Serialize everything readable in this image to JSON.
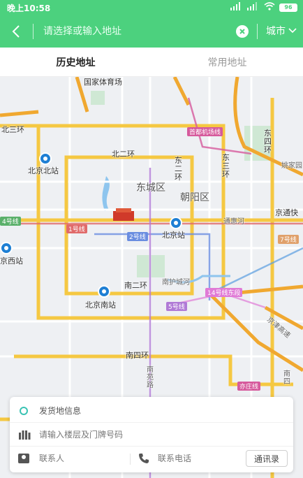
{
  "status_bar": {
    "time": "晚上10:58",
    "battery": "96"
  },
  "search": {
    "placeholder": "请选择或输入地址",
    "city_label": "城市"
  },
  "tabs": [
    {
      "label": "历史地址",
      "active": true
    },
    {
      "label": "常用地址",
      "active": false
    }
  ],
  "map": {
    "labels": {
      "stadium": "国家体育场",
      "north_3rd_ring": "北三环",
      "north_2nd_ring": "北二环",
      "east_2nd_ring": "东二环",
      "east_3rd_ring": "东三环",
      "east_4th_ring": "东四环",
      "dongcheng": "东城区",
      "chaoyang": "朝阳区",
      "beijing_north_station": "北京北站",
      "beijing_station": "北京站",
      "beijing_west_station": "京西站",
      "beijing_south_station": "北京南站",
      "south_2nd_ring": "南二环",
      "south_4th_ring": "南四环",
      "nanhucheng_river": "南护城河",
      "tonghui_river": "通惠河",
      "yaojia_road": "姚家园",
      "jingtong_express": "京通快",
      "south_central_road": "南苑路",
      "airport_line": "首都机场线",
      "line_1": "1号线",
      "line_2": "2号线",
      "line_4": "4号线",
      "line_5": "5号线",
      "line_7": "7号线",
      "line_14": "14号线东段",
      "yizhuang_line": "亦庄线",
      "jingjin_expressway": "京津高速",
      "south_4th_road": "南四"
    }
  },
  "card": {
    "origin_label": "发货地信息",
    "floor_placeholder": "请输入楼层及门牌号码",
    "contact_placeholder": "联系人",
    "phone_placeholder": "联系电话",
    "contacts_button": "通讯录"
  },
  "colors": {
    "brand": "#4cd17e",
    "ring_road": "#f5c842",
    "highway": "#f0a830",
    "teal_icon": "#3ac3b4",
    "station_blue": "#1e7fd4"
  }
}
